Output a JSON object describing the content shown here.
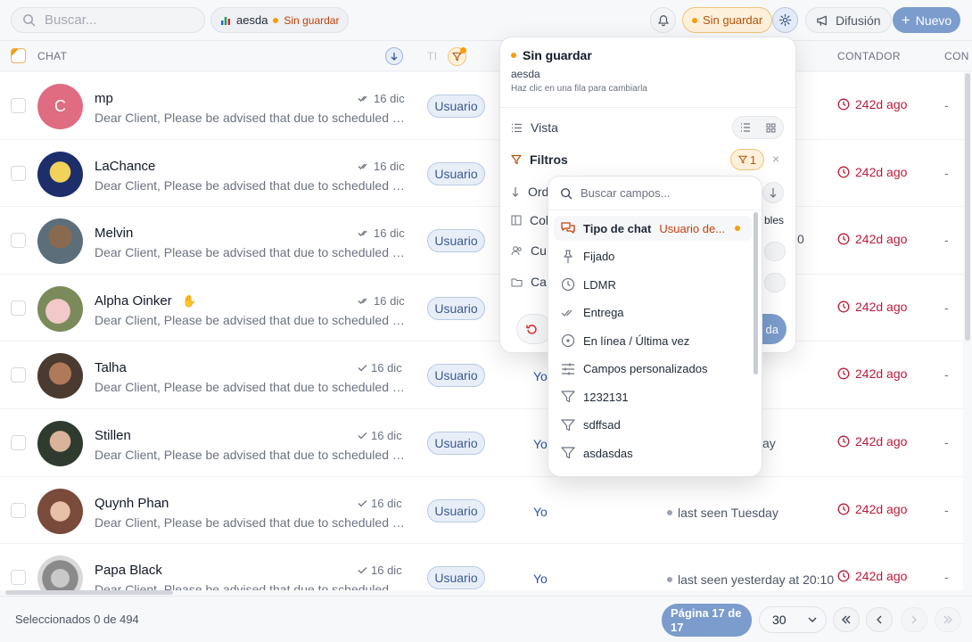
{
  "search": {
    "placeholder": "Buscar..."
  },
  "view": {
    "name": "aesda",
    "unsaved_label": "Sin guardar"
  },
  "topbar": {
    "unsaved_label": "Sin guardar",
    "broadcast_label": "Difusión",
    "new_label": "Nuevo"
  },
  "columns": {
    "chat": "CHAT",
    "type_short": "TI",
    "counter": "CONTADOR",
    "contact_short": "CON"
  },
  "rows": [
    {
      "name": "mp",
      "initial": "C",
      "message": "Dear Client, Please be advised that due to scheduled ma...",
      "date": "16 dic",
      "badge": "Usuario",
      "owner": "",
      "seen": "",
      "counter": "242d ago",
      "extra": "-"
    },
    {
      "name": "LaChance",
      "message": "Dear Client, Please be advised that due to scheduled ma...",
      "date": "16 dic",
      "badge": "Usuario",
      "owner": "",
      "seen": "",
      "counter": "242d ago",
      "extra": "-"
    },
    {
      "name": "Melvin",
      "message": "Dear Client, Please be advised that due to scheduled ma...",
      "date": "16 dic",
      "badge": "Usuario",
      "owner": "",
      "seen": "0",
      "counter": "242d ago",
      "extra": "-"
    },
    {
      "name": "Alpha Oinker",
      "message": "Dear Client, Please be advised that due to scheduled ma...",
      "date": "16 dic",
      "badge": "Usuario",
      "owner": "",
      "seen": "",
      "counter": "242d ago",
      "extra": "-"
    },
    {
      "name": "Talha",
      "message": "Dear Client, Please be advised that due to scheduled ma...",
      "date": "16 dic",
      "badge": "Usuario",
      "owner": "Yo",
      "seen": "",
      "counter": "242d ago",
      "extra": "-"
    },
    {
      "name": "Stillen",
      "message": "Dear Client, Please be advised that due to scheduled ma...",
      "date": "16 dic",
      "badge": "Usuario",
      "owner": "Yo",
      "seen": "ay",
      "counter": "242d ago",
      "extra": "-"
    },
    {
      "name": "Quynh Phan",
      "message": "Dear Client, Please be advised that due to scheduled ma...",
      "date": "16 dic",
      "badge": "Usuario",
      "owner": "Yo",
      "seen": "last seen Tuesday",
      "counter": "242d ago",
      "extra": "-"
    },
    {
      "name": "Papa Black",
      "message": "Dear Client, Please be advised that due to scheduled ma...",
      "date": "16 dic",
      "badge": "Usuario",
      "owner": "Yo",
      "seen": "last seen yesterday at 20:10",
      "counter": "242d ago",
      "extra": "-"
    }
  ],
  "footer": {
    "selected": "Seleccionados 0 de 494",
    "page": "Página 17 de 17",
    "page_size": "30"
  },
  "panel": {
    "title": "Sin guardar",
    "view_name": "aesda",
    "hint": "Haz clic en una fila para cambiarla",
    "vista": "Vista",
    "filtros": "Filtros",
    "filter_count": "1",
    "orden_short": "Ord",
    "columnas_short": "Col",
    "columnas_tail": "bles",
    "cu_short": "Cu",
    "ca_short": "Ca",
    "save_tail": "da"
  },
  "picker": {
    "placeholder": "Buscar campos...",
    "items": [
      {
        "label": "Tipo de chat",
        "value": "Usuario de...",
        "icon": "chat-type-icon"
      },
      {
        "label": "Fijado",
        "icon": "pin-icon"
      },
      {
        "label": "LDMR",
        "icon": "clock-icon"
      },
      {
        "label": "Entrega",
        "icon": "double-check-icon"
      },
      {
        "label": "En línea / Última vez",
        "icon": "presence-icon"
      },
      {
        "label": "Campos personalizados",
        "icon": "sliders-icon"
      },
      {
        "label": "1232131",
        "icon": "filter-icon"
      },
      {
        "label": "sdffsad",
        "icon": "filter-icon"
      },
      {
        "label": "asdasdas",
        "icon": "filter-icon"
      }
    ]
  },
  "colors": {
    "accent": "#7b9ccc",
    "warning": "#f59e0b",
    "counter": "#b91c3c",
    "badge_bg": "#e8eef8"
  }
}
